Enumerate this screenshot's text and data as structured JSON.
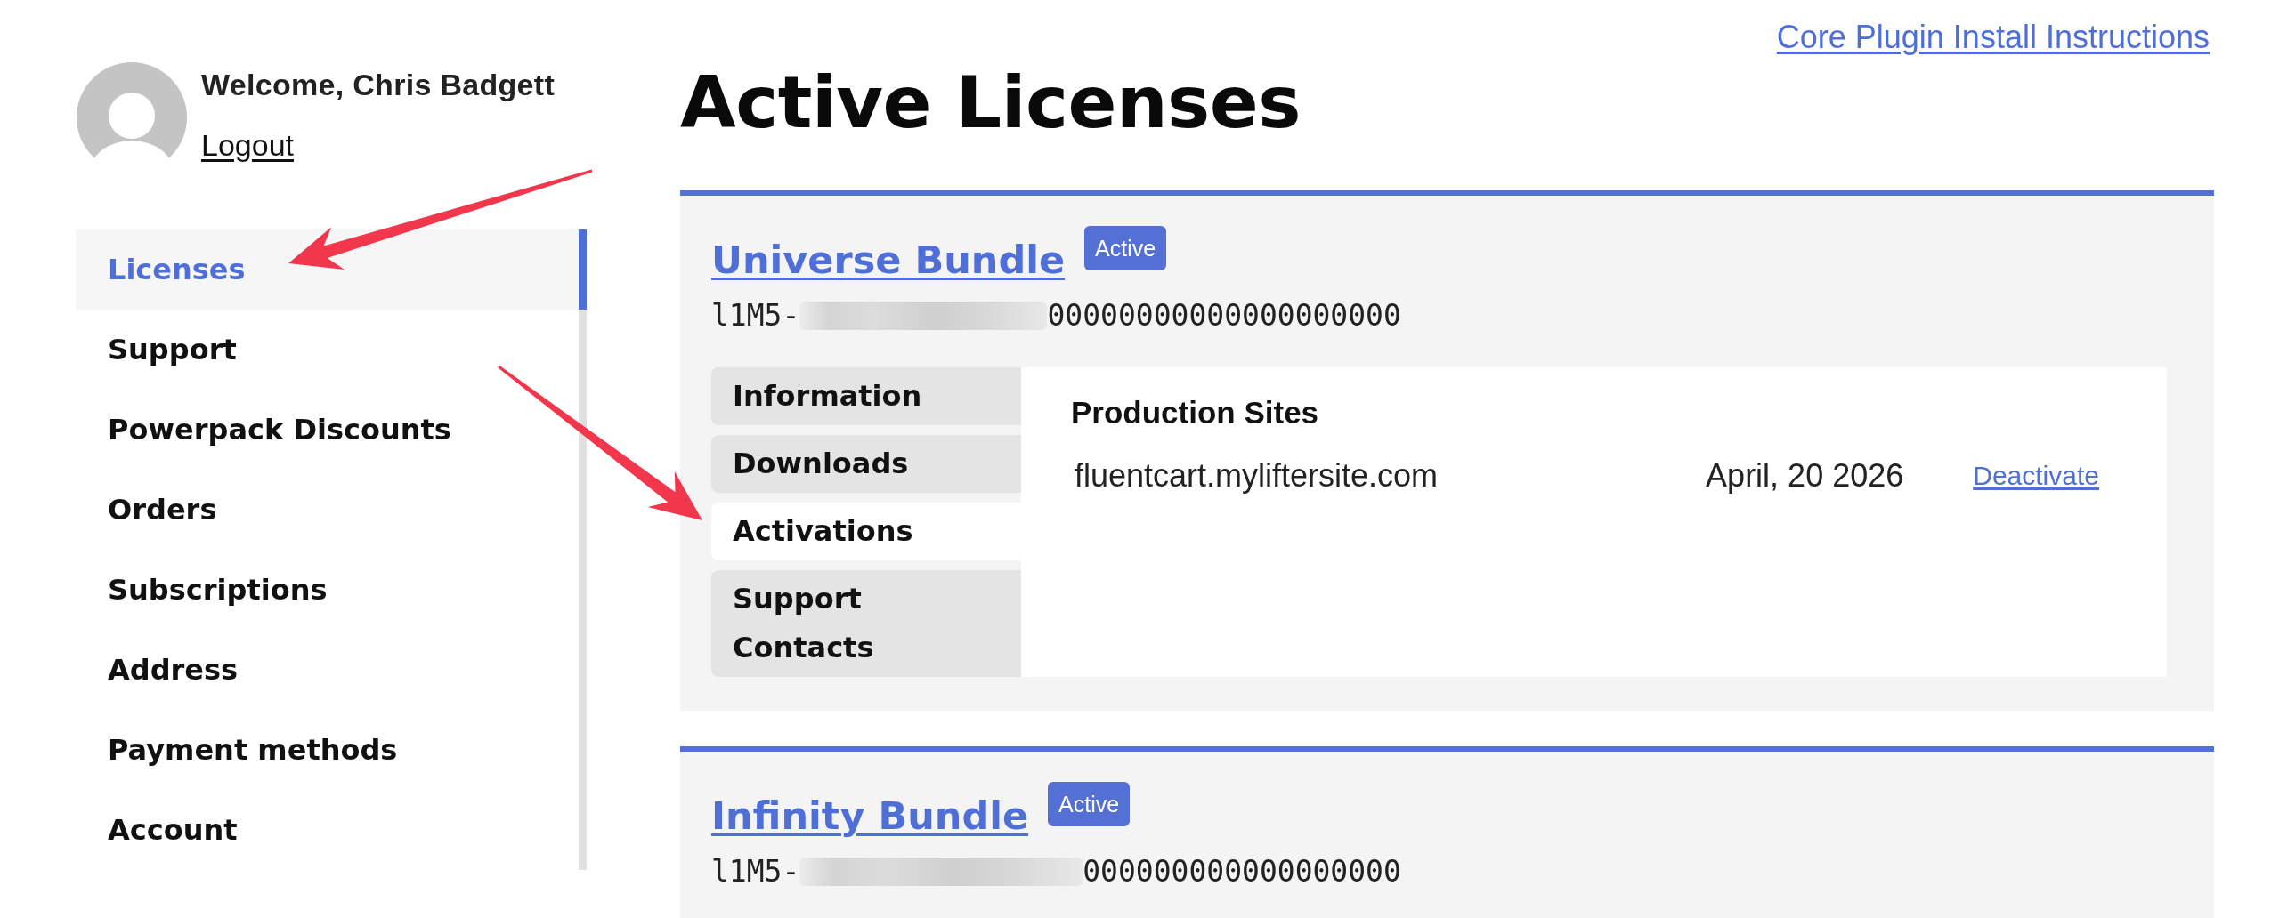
{
  "top_link": {
    "text": "Core Plugin Install Instructions"
  },
  "user": {
    "greeting": "Welcome, Chris Badgett",
    "logout": "Logout"
  },
  "sidebar": {
    "items": [
      {
        "label": "Licenses",
        "selected": true
      },
      {
        "label": "Support",
        "selected": false
      },
      {
        "label": "Powerpack Discounts",
        "selected": false
      },
      {
        "label": "Orders",
        "selected": false
      },
      {
        "label": "Subscriptions",
        "selected": false
      },
      {
        "label": "Address",
        "selected": false
      },
      {
        "label": "Payment methods",
        "selected": false
      },
      {
        "label": "Account",
        "selected": false
      }
    ]
  },
  "page_title": "Active Licenses",
  "licenses": [
    {
      "name": "Universe Bundle",
      "status": "Active",
      "key": [
        {
          "kind": "text",
          "text": "l1M5-"
        },
        {
          "kind": "blurred"
        },
        {
          "kind": "text",
          "text": "00000000000000000000"
        }
      ],
      "tabs": [
        {
          "label": "Information",
          "selected": false
        },
        {
          "label": "Downloads",
          "selected": false
        },
        {
          "label": "Activations",
          "selected": true
        },
        {
          "label": "Support Contacts",
          "selected": false
        }
      ],
      "activations": {
        "heading": "Production Sites",
        "rows": [
          {
            "site": "fluentcart.myliftersite.com",
            "date": "April, 20 2026",
            "action": "Deactivate"
          }
        ]
      }
    },
    {
      "name": "Infinity Bundle",
      "status": "Active",
      "key": [
        {
          "kind": "text",
          "text": "l1M5-"
        },
        {
          "kind": "blurred"
        },
        {
          "kind": "text",
          "text": "000000000000000000"
        }
      ]
    }
  ],
  "annotations": [
    {
      "kind": "arrow"
    },
    {
      "kind": "arrow"
    }
  ]
}
